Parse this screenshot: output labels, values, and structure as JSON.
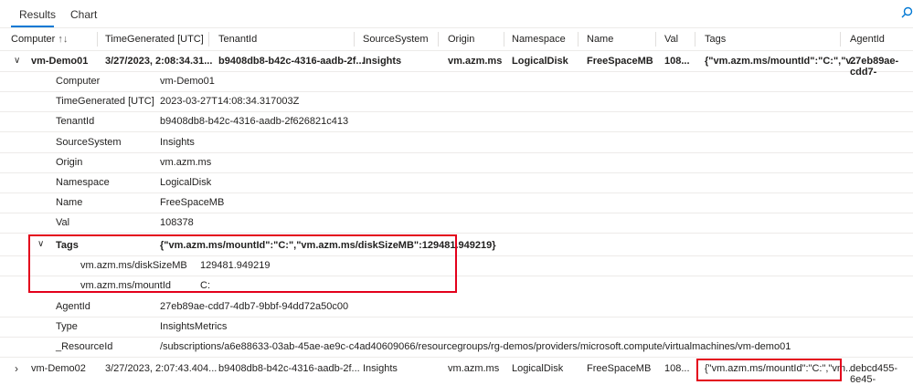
{
  "tabs": [
    {
      "label": "Results",
      "active": true
    },
    {
      "label": "Chart",
      "active": false
    }
  ],
  "icons": {
    "search": "search-icon"
  },
  "columns": [
    {
      "label": "Computer",
      "sort": "↑↓"
    },
    {
      "label": "TimeGenerated [UTC]"
    },
    {
      "label": "TenantId"
    },
    {
      "label": "SourceSystem"
    },
    {
      "label": "Origin"
    },
    {
      "label": "Namespace"
    },
    {
      "label": "Name"
    },
    {
      "label": "Val"
    },
    {
      "label": "Tags"
    },
    {
      "label": "AgentId"
    }
  ],
  "rows": [
    {
      "expanded": true,
      "chevron": "∨",
      "cells": [
        "vm-Demo01",
        "3/27/2023, 2:08:34.31...",
        "b9408db8-b42c-4316-aadb-2f...",
        "Insights",
        "vm.azm.ms",
        "LogicalDisk",
        "FreeSpaceMB",
        "108...",
        "{\"vm.azm.ms/mountId\":\"C:\",\"v...",
        "27eb89ae-cdd7-"
      ]
    },
    {
      "expanded": false,
      "chevron": "›",
      "cells": [
        "vm-Demo02",
        "3/27/2023, 2:07:43.404...",
        "b9408db8-b42c-4316-aadb-2f...",
        "Insights",
        "vm.azm.ms",
        "LogicalDisk",
        "FreeSpaceMB",
        "108...",
        "{\"vm.azm.ms/mountId\":\"C:\",\"vm...",
        "debcd455-6e45-"
      ]
    }
  ],
  "details": [
    {
      "key": "Computer",
      "value": "vm-Demo01"
    },
    {
      "key": "TimeGenerated [UTC]",
      "value": "2023-03-27T14:08:34.317003Z"
    },
    {
      "key": "TenantId",
      "value": "b9408db8-b42c-4316-aadb-2f626821c413"
    },
    {
      "key": "SourceSystem",
      "value": "Insights"
    },
    {
      "key": "Origin",
      "value": "vm.azm.ms"
    },
    {
      "key": "Namespace",
      "value": "LogicalDisk"
    },
    {
      "key": "Name",
      "value": "FreeSpaceMB"
    },
    {
      "key": "Val",
      "value": "108378"
    }
  ],
  "tags": {
    "chevron": "∨",
    "key": "Tags",
    "value": "{\"vm.azm.ms/mountId\":\"C:\",\"vm.azm.ms/diskSizeMB\":129481.949219}",
    "sub": [
      {
        "key": "vm.azm.ms/diskSizeMB",
        "value": "129481.949219"
      },
      {
        "key": "vm.azm.ms/mountId",
        "value": "C:"
      }
    ]
  },
  "details_after": [
    {
      "key": "AgentId",
      "value": "27eb89ae-cdd7-4db7-9bbf-94dd72a50c00"
    },
    {
      "key": "Type",
      "value": "InsightsMetrics"
    },
    {
      "key": "_ResourceId",
      "value": "/subscriptions/a6e88633-03ab-45ae-ae9c-c4ad40609066/resourcegroups/rg-demos/providers/microsoft.compute/virtualmachines/vm-demo01"
    }
  ],
  "colors": {
    "accent": "#0078d4",
    "highlight": "#e3001b"
  }
}
